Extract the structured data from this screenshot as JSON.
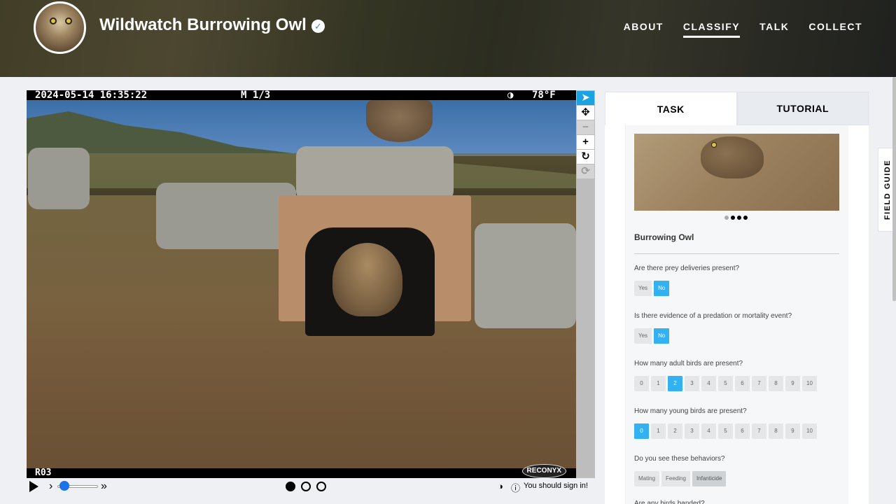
{
  "header": {
    "project_title": "Wildwatch Burrowing Owl",
    "nav": [
      "ABOUT",
      "CLASSIFY",
      "TALK",
      "COLLECT"
    ],
    "active_nav": "CLASSIFY"
  },
  "camera": {
    "timestamp": "2024-05-14 16:35:22",
    "frame": "M 1/3",
    "moon": "◑",
    "temperature": "78°F",
    "site_code": "R03",
    "brand": "RECONYX"
  },
  "controls": {
    "signin_text": "You should sign in!"
  },
  "tabs": [
    "TASK",
    "TUTORIAL"
  ],
  "field_guide_label": "FIELD GUIDE",
  "task": {
    "species_name": "Burrowing Owl",
    "questions": [
      {
        "text": "Are there prey deliveries present?",
        "options": [
          "Yes",
          "No"
        ],
        "selected": "No"
      },
      {
        "text": "Is there evidence of a predation or mortality event?",
        "options": [
          "Yes",
          "No"
        ],
        "selected": "No"
      },
      {
        "text": "How many adult birds are present?",
        "options": [
          "0",
          "1",
          "2",
          "3",
          "4",
          "5",
          "6",
          "7",
          "8",
          "9",
          "10"
        ],
        "selected": "2"
      },
      {
        "text": "How many young birds are present?",
        "options": [
          "0",
          "1",
          "2",
          "3",
          "4",
          "5",
          "6",
          "7",
          "8",
          "9",
          "10"
        ],
        "selected": "0"
      },
      {
        "text": "Do you see these behaviors?",
        "options": [
          "Mating",
          "Feeding",
          "Infanticide"
        ],
        "selected": ""
      }
    ],
    "next_question_partial": "Are any birds banded?"
  },
  "colors": {
    "accent": "#34b1f2",
    "header_text": "#ffffff",
    "tool_active": "#1aa3e0"
  }
}
